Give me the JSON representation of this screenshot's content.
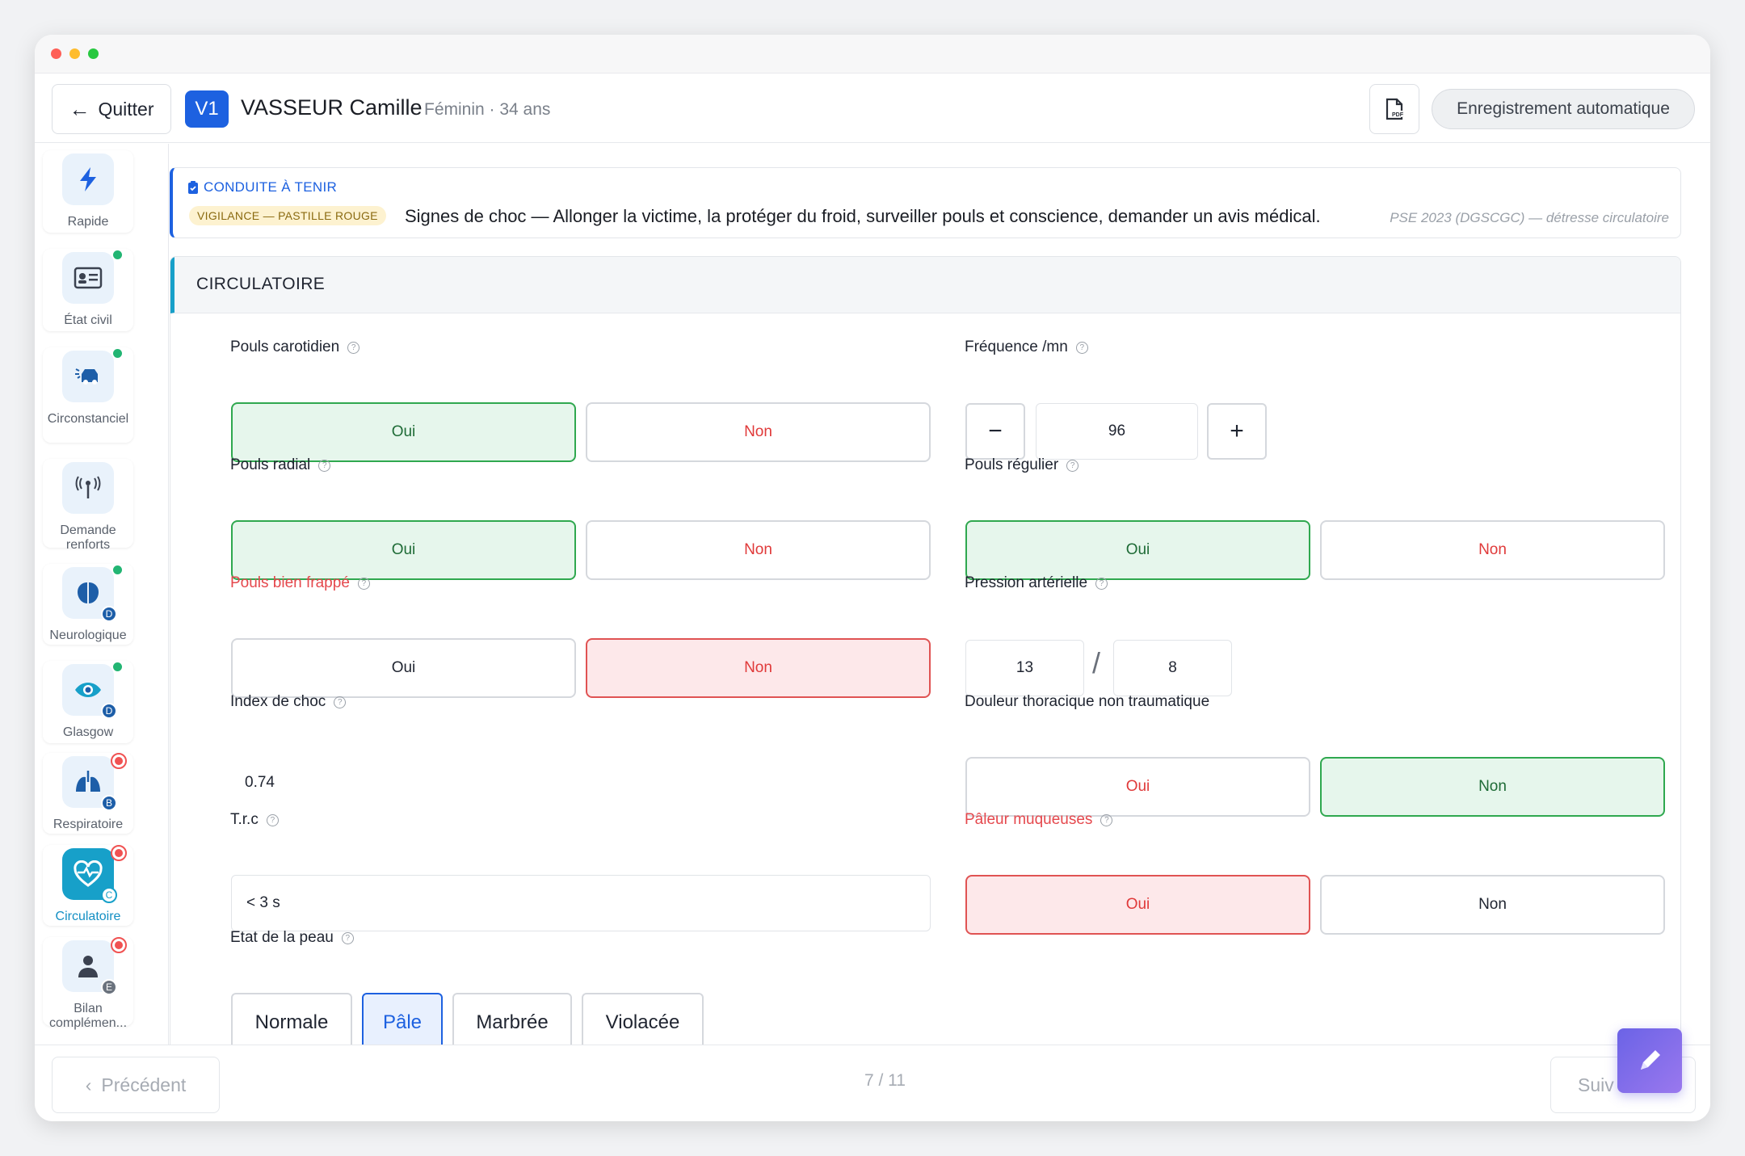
{
  "header": {
    "quit_label": "Quitter",
    "patient_badge": "V1",
    "patient_name": "VASSEUR Camille",
    "patient_meta": "Féminin · 34 ans",
    "pdf_icon": "pdf-icon",
    "autosave_label": "Enregistrement automatique"
  },
  "sidebar": {
    "items": [
      {
        "label": "Rapide",
        "icon": "lightning-icon"
      },
      {
        "label": "État civil",
        "icon": "id-card-icon"
      },
      {
        "label": "Circonstanciel",
        "icon": "car-crash-icon"
      },
      {
        "label": "Demande renforts",
        "icon": "antenna-icon"
      },
      {
        "label": "Neurologique",
        "icon": "brain-icon",
        "badge": "D"
      },
      {
        "label": "Glasgow",
        "icon": "eye-icon",
        "badge": "D"
      },
      {
        "label": "Respiratoire",
        "icon": "lungs-icon",
        "badge": "B"
      },
      {
        "label": "Circulatoire",
        "icon": "heart-pulse-icon",
        "badge": "C"
      },
      {
        "label": "Bilan complémen...",
        "icon": "person-icon",
        "badge": "E"
      }
    ]
  },
  "conduite": {
    "title": "CONDUITE À TENIR",
    "badge": "VIGILANCE — PASTILLE ROUGE",
    "text": "Signes de choc — Allonger la victime, la protéger du froid, surveiller pouls et conscience, demander un avis médical.",
    "source": "PSE 2023 (DGSCGC) — détresse circulatoire"
  },
  "section": {
    "title": "CIRCULATOIRE",
    "help_glyph": "?",
    "oui": "Oui",
    "non": "Non",
    "pouls_carotidien": "Pouls carotidien",
    "pouls_radial": "Pouls radial",
    "pouls_bien_frappe": "Pouls bien frappé",
    "index_choc_label": "Index de choc",
    "index_choc_value": "0.74",
    "trc_label": "T.r.c",
    "trc_value": "< 3 s",
    "peau_label": "Etat de la peau",
    "peau_options": [
      "Normale",
      "Pâle",
      "Marbrée",
      "Violacée"
    ],
    "frequence_label": "Fréquence /mn",
    "frequence_value": "96",
    "minus": "−",
    "plus": "+",
    "pouls_regulier": "Pouls régulier",
    "pression_label": "Pression artérielle",
    "pression_sys": "13",
    "pression_sep": "/",
    "pression_dia": "8",
    "douleur_label": "Douleur thoracique non traumatique",
    "paleur_label": "Pâleur muqueuses"
  },
  "footer": {
    "prev_label": "Précédent",
    "pager": "7 / 11",
    "next_label": "Suiv"
  },
  "colors": {
    "accent": "#1d61e0",
    "teal": "#17a0c9",
    "green_sel": "#2fa84f",
    "red_sel": "#e05353"
  }
}
